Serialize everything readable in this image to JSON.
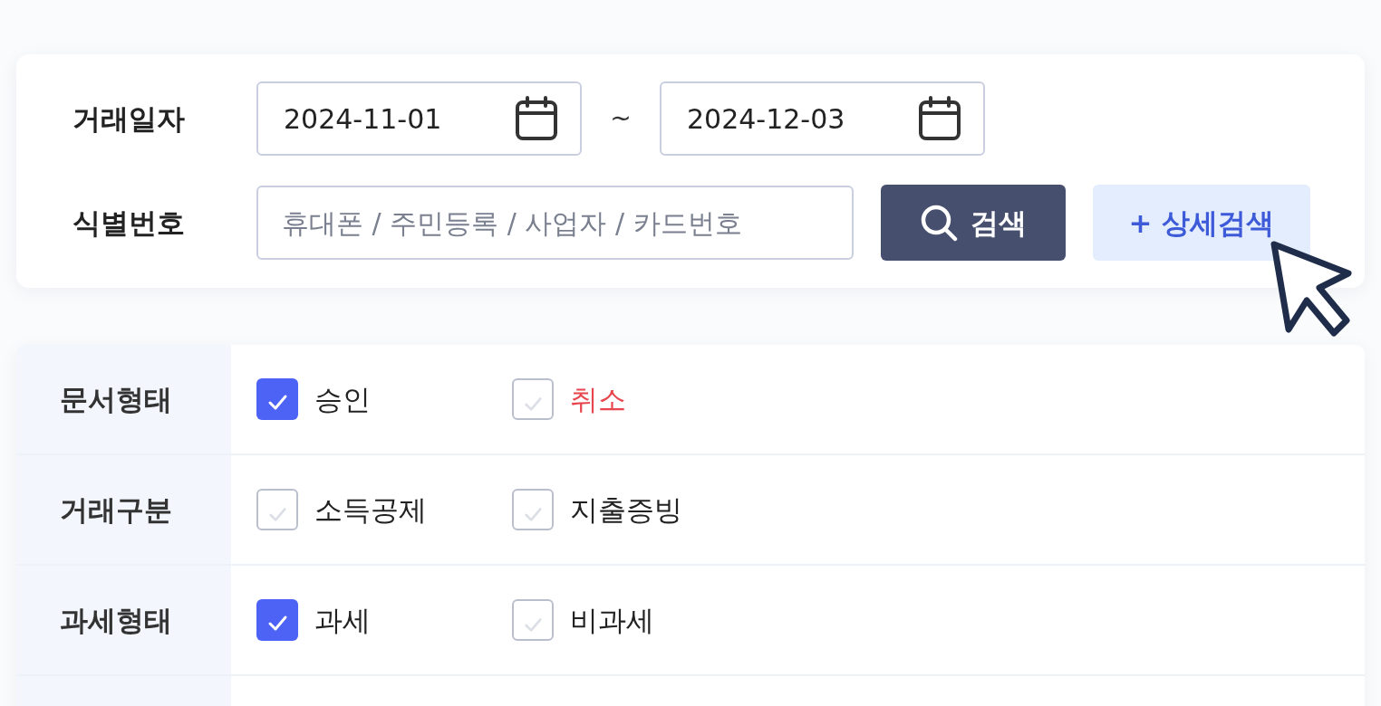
{
  "search_card": {
    "date_label": "거래일자",
    "date_from": "2024-11-01",
    "separator": "~",
    "date_to": "2024-12-03",
    "id_label": "식별번호",
    "id_placeholder": "휴대폰 / 주민등록 / 사업자 / 카드번호",
    "search_button": "검색",
    "detail_button": "+ 상세검색"
  },
  "filters": [
    {
      "label": "문서형태",
      "options": [
        {
          "text": "승인",
          "checked": true
        },
        {
          "text": "취소",
          "checked": false,
          "color": "#e8464e"
        }
      ]
    },
    {
      "label": "거래구분",
      "options": [
        {
          "text": "소득공제",
          "checked": false
        },
        {
          "text": "지출증빙",
          "checked": false
        }
      ]
    },
    {
      "label": "과세형태",
      "options": [
        {
          "text": "과세",
          "checked": true
        },
        {
          "text": "비과세",
          "checked": false
        }
      ]
    }
  ]
}
